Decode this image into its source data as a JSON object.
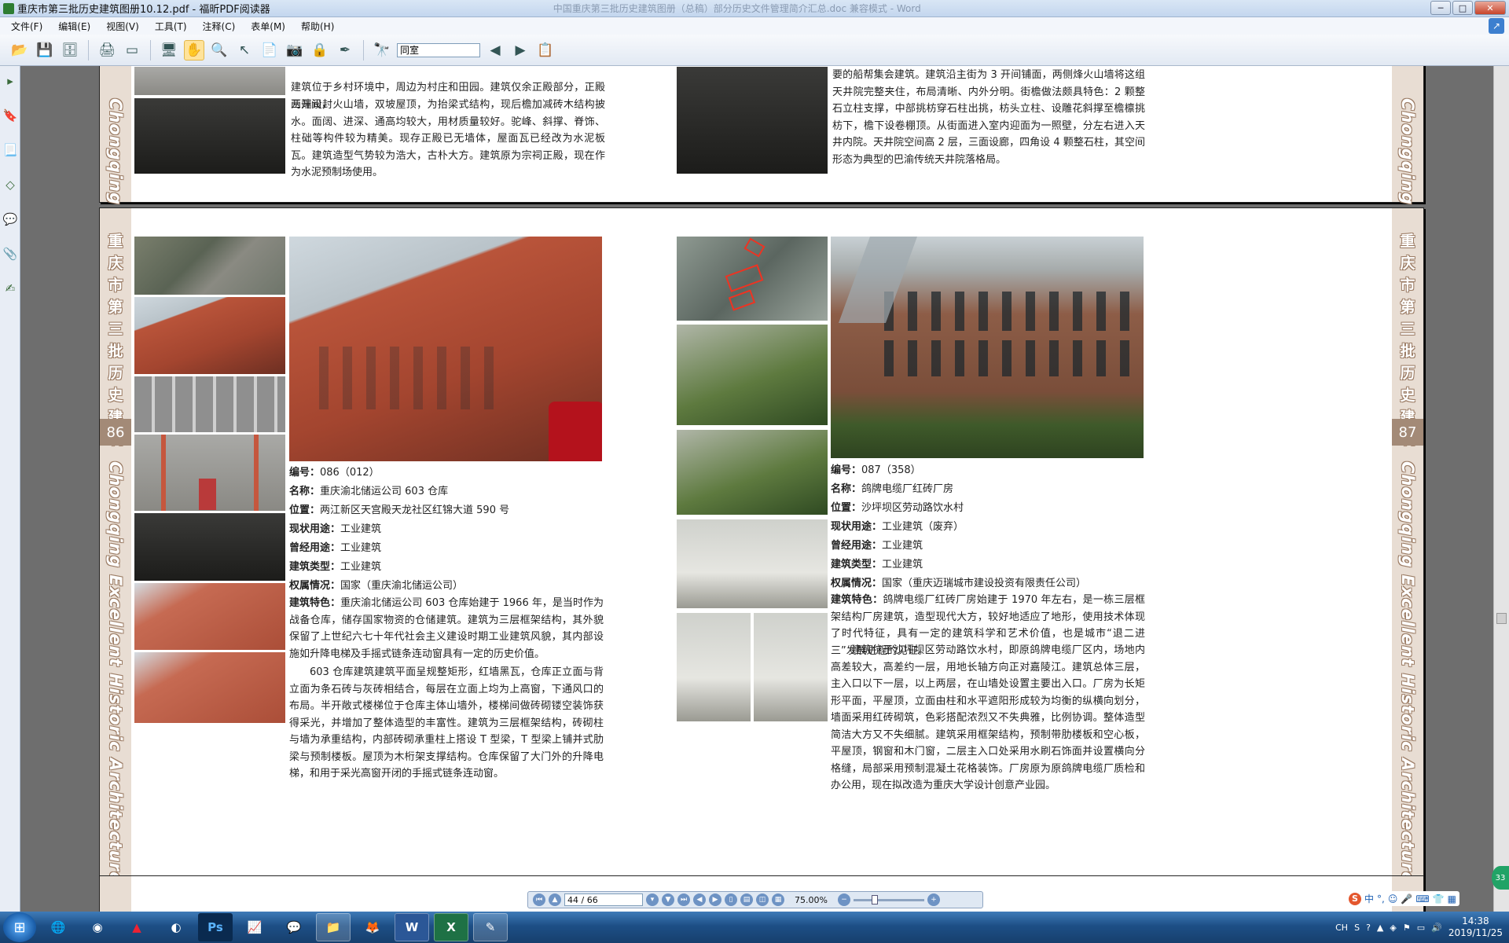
{
  "window": {
    "title": "重庆市第三批历史建筑图册10.12.pdf - 福昕PDF阅读器",
    "faded_title": "中国重庆第三批历史建筑图册（总稿）部分历史文件管理简介汇总.doc 兼容模式 - Word",
    "minimize": "─",
    "maximize": "□",
    "close": "✕"
  },
  "menu": [
    "文件(F)",
    "编辑(E)",
    "视图(V)",
    "工具(T)",
    "注释(C)",
    "表单(M)",
    "帮助(H)"
  ],
  "toolbar": {
    "search_value": "同室"
  },
  "page_top": {
    "left_text": "两端设封火山墙，双坡屋顶，为抬梁式结构，现后檐加减砖木结构披水。面阔、进深、通高均较大，用材质量较好。驼峰、斜撑、脊饰、柱础等构件较为精美。现存正殿已无墙体，屋面瓦已经改为水泥板瓦。建筑造型气势较为浩大，古朴大方。建筑原为宗祠正殿，现在作为水泥预制场使用。",
    "left_text_first": "建筑位于乡村环境中，周边为村庄和田园。建筑仅余正殿部分，正殿三开间，",
    "right_text": "要的船帮集会建筑。建筑沿主街为 3 开间铺面，两侧烽火山墙将这组天井院完整夹住，布局清晰、内外分明。街檐做法颇具特色：2 颗整石立柱支撑，中部挑枋穿石柱出挑，枋头立柱、设雕花斜撑至檐檩挑枋下，檐下设卷棚顶。从街面进入室内迎面为一照壁，分左右进入天井内院。天井院空间高 2 层，三面设廊，四角设 4 颗整石柱，其空间形态为典型的巴渝传统天井院落格局。"
  },
  "side": {
    "cn_title": [
      "重",
      "庆",
      "市",
      "第",
      "三",
      "批",
      "历",
      "史",
      "建",
      "筑"
    ],
    "en_title": "Chongqing Excellent Historic Architecture",
    "page_left": "86",
    "page_right": "87"
  },
  "left_building": {
    "labels": {
      "id": "编号：",
      "name": "名称：",
      "location": "位置：",
      "current_use": "现状用途：",
      "former_use": "曾经用途：",
      "type": "建筑类型：",
      "ownership": "权属情况：",
      "features": "建筑特色："
    },
    "id": "086（012）",
    "name": "重庆渝北储运公司 603 仓库",
    "location": "两江新区天宫殿天龙社区红锦大道 590 号",
    "current_use": "工业建筑",
    "former_use": "工业建筑",
    "type": "工业建筑",
    "ownership": "国家（重庆渝北储运公司）",
    "features": "重庆渝北储运公司 603 仓库始建于 1966 年，是当时作为战备仓库，储存国家物资的仓储建筑。建筑为三层框架结构，其外貌保留了上世纪六七十年代社会主义建设时期工业建筑风貌，其内部设施如升降电梯及手摇式链条连动窗具有一定的历史价值。",
    "para2": "603 仓库建筑建筑平面呈规整矩形，红墙黑瓦，仓库正立面与背立面为条石砖与灰砖相结合，每层在立面上均为上高窗，下通风口的布局。半开敞式楼梯位于仓库主体山墙外，楼梯间做砖砌镂空装饰获得采光，并增加了整体造型的丰富性。建筑为三层框架结构，砖砌柱与墙为承重结构，内部砖砌承重柱上搭设 T 型梁，T 型梁上铺并式肋梁与预制楼板。屋顶为木桁架支撑结构。仓库保留了大门外的升降电梯，和用于采光高窗开闭的手摇式链条连动窗。"
  },
  "right_building": {
    "id": "087（358）",
    "name": "鸽牌电缆厂红砖厂房",
    "location": "沙坪坝区劳动路饮水村",
    "current_use": "工业建筑（废弃）",
    "former_use": "工业建筑",
    "type": "工业建筑",
    "ownership": "国家（重庆迈瑞城市建设投资有限责任公司）",
    "features": "鸽牌电缆厂红砖厂房始建于 1970 年左右，是一栋三层框架结构厂房建筑，造型现代大方，较好地适应了地形，使用技术体现了时代特征，具有一定的建筑科学和艺术价值，也是城市“退二进三”发展进程的见证。",
    "para2": "建筑位于沙坪坝区劳动路饮水村，即原鸽牌电缆厂区内，场地内高差较大，高差约一层，用地长轴方向正对嘉陵江。建筑总体三层，主入口以下一层，以上两层，在山墙处设置主要出入口。厂房为长矩形平面，平屋顶，立面由柱和水平遮阳形成较为均衡的纵横向划分，墙面采用红砖砌筑，色彩搭配浓烈又不失典雅，比例协调。整体造型简洁大方又不失细腻。建筑采用框架结构，预制带肋楼板和空心板，平屋顶，钢窗和木门窗，二层主入口处采用水刷石饰面并设置横向分格缝，局部采用预制混凝土花格装饰。厂房原为原鸽牌电缆厂质检和办公用，现在拟改造为重庆大学设计创意产业园。"
  },
  "nav": {
    "page_value": "44 / 66",
    "zoom_value": "75.00%",
    "zoom_level_percent": 30
  },
  "taskbar": {
    "apps": [
      "Ps",
      "W",
      "X"
    ],
    "tray_lang": "CH",
    "time": "14:38",
    "date": "2019/11/25",
    "ime_label": "中",
    "ime_punct": "°,",
    "badge_count": "33"
  }
}
